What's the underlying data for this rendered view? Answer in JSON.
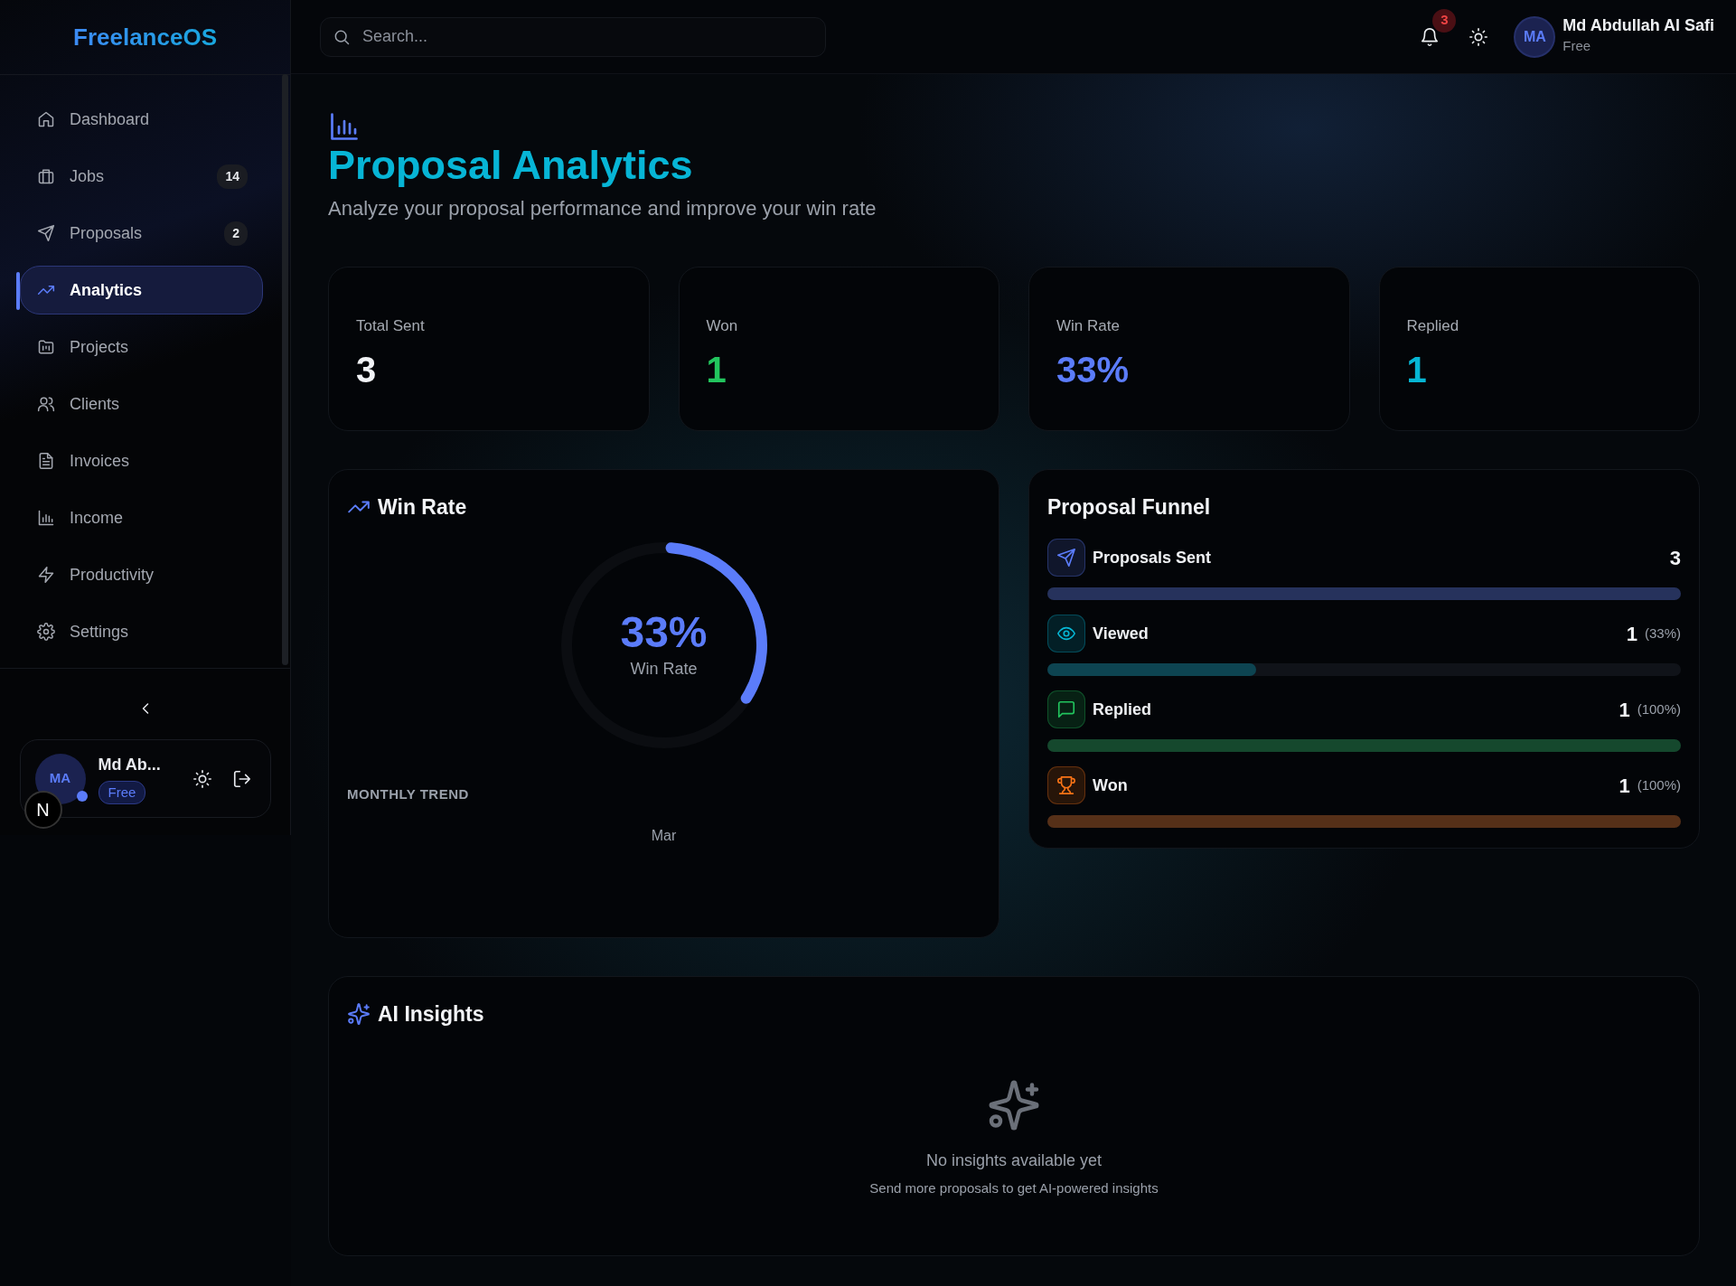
{
  "sidebar": {
    "logo": "FreelanceOS",
    "items": [
      {
        "label": "Dashboard",
        "selected": false
      },
      {
        "label": "Jobs",
        "badge": "14",
        "selected": false
      },
      {
        "label": "Proposals",
        "badge": "2",
        "selected": false
      },
      {
        "label": "Analytics",
        "selected": true
      },
      {
        "label": "Projects",
        "selected": false
      },
      {
        "label": "Clients",
        "selected": false
      },
      {
        "label": "Invoices",
        "selected": false
      },
      {
        "label": "Income",
        "selected": false
      },
      {
        "label": "Productivity",
        "selected": false
      },
      {
        "label": "Settings",
        "selected": false
      }
    ],
    "user": {
      "initials": "MA",
      "name": "Md Ab...",
      "plan": "Free",
      "online": true
    },
    "dev_indicator": "N"
  },
  "header": {
    "search": {
      "placeholder": "Search..."
    },
    "notifications": "3",
    "user": {
      "initials": "MA",
      "name": "Md Abdullah Al Safi",
      "plan": "Free"
    }
  },
  "page": {
    "title": "Proposal Analytics",
    "subtitle": "Analyze your proposal performance and improve your win rate"
  },
  "stats": [
    {
      "label": "Total Sent",
      "value": "3",
      "color": "#f2f4f7"
    },
    {
      "label": "Won",
      "value": "1",
      "color": "#22c55e"
    },
    {
      "label": "Win Rate",
      "value": "33%",
      "color": "#5b7cfa"
    },
    {
      "label": "Replied",
      "value": "1",
      "color": "#06b6d4"
    }
  ],
  "win_rate": {
    "title": "Win Rate",
    "value": "33%",
    "caption": "Win Rate",
    "level": 0.33,
    "trend_title": "MONTHLY TREND",
    "trend_months": [
      "Mar"
    ]
  },
  "funnel": {
    "title": "Proposal Funnel",
    "stages": [
      {
        "label": "Proposals Sent",
        "count": "3",
        "level": 1,
        "color": "#5b7cfa"
      },
      {
        "label": "Viewed",
        "count": "1",
        "percent": "(33%)",
        "level": 0.33,
        "color": "#06b6d4"
      },
      {
        "label": "Replied",
        "count": "1",
        "percent": "(100%)",
        "level": 1,
        "color": "#22c55e"
      },
      {
        "label": "Won",
        "count": "1",
        "percent": "(100%)",
        "level": 1,
        "color": "#f97316"
      }
    ]
  },
  "insights": {
    "title": "AI Insights",
    "empty_title": "No insights available yet",
    "empty_text": "Send more proposals to get AI-powered insights"
  }
}
